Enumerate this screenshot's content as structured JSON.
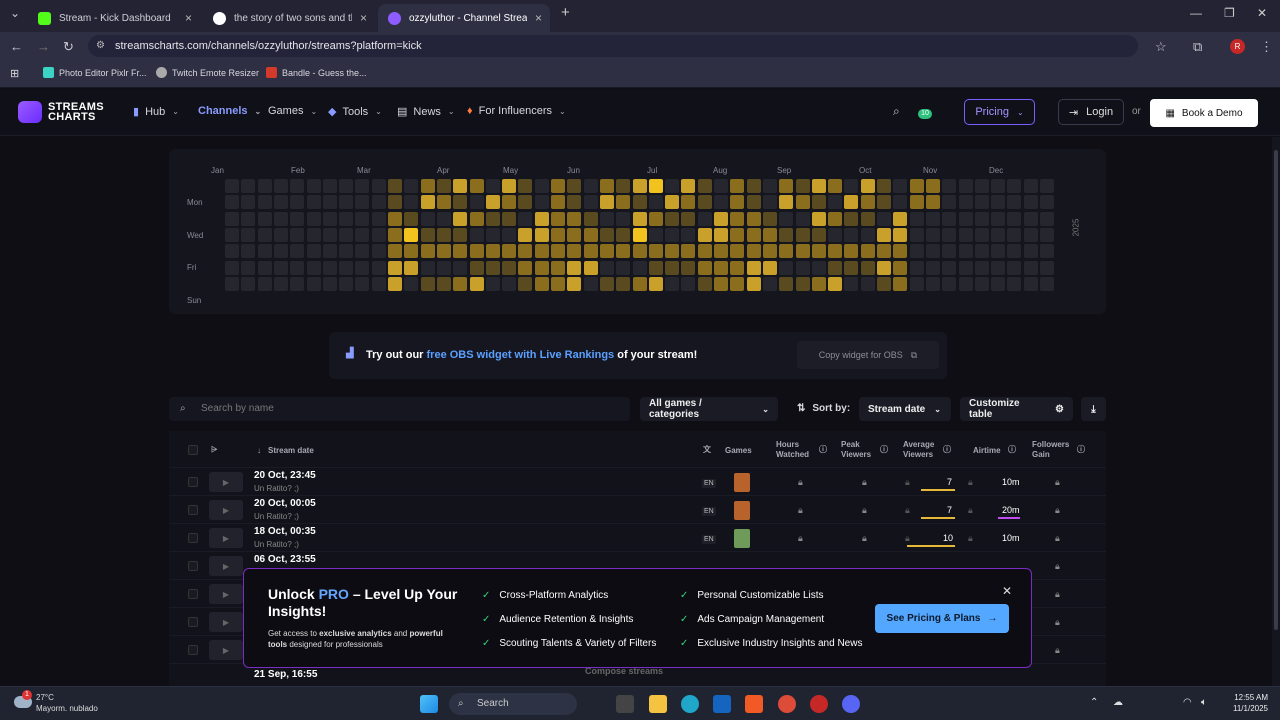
{
  "browser": {
    "tabs": [
      {
        "title": "Stream - Kick Dashboard",
        "icon": "kick-icon",
        "color": "#53fc18"
      },
      {
        "title": "the story of two sons and their",
        "icon": "google-icon",
        "color": "#ffffff"
      },
      {
        "title": "ozzyluthor - Channel Streams o",
        "icon": "streamscharts-icon",
        "color": "#8f5cff"
      }
    ],
    "url": "streamscharts.com/channels/ozzyluthor/streams?platform=kick",
    "bookmarks": [
      {
        "label": "Photo Editor Pixlr Fr...",
        "color": "#3bd4c4"
      },
      {
        "label": "Twitch Emote Resizer",
        "color": "#aaaaaa"
      },
      {
        "label": "Bandle - Guess the...",
        "color": "#d33a2c"
      }
    ],
    "profile": "R"
  },
  "site": {
    "logo": "STREAMS CHARTS",
    "nav": [
      {
        "label": "Hub"
      },
      {
        "label": "Channels"
      },
      {
        "label": "Games"
      },
      {
        "label": "Tools"
      },
      {
        "label": "News"
      },
      {
        "label": "For Influencers"
      }
    ],
    "badge": "10",
    "pricing": "Pricing",
    "login": "Login",
    "or": "or",
    "demo": "Book a Demo"
  },
  "heatmap": {
    "months": [
      "Jan",
      "Feb",
      "Mar",
      "Apr",
      "May",
      "Jun",
      "Jul",
      "Aug",
      "Sep",
      "Oct",
      "Nov",
      "Dec"
    ],
    "days": [
      "Mon",
      "Wed",
      "Fri",
      "Sun"
    ],
    "year": "2025"
  },
  "obs": {
    "prefix": "Try out our",
    "link": "free OBS widget with Live Rankings",
    "suffix": "of your stream!",
    "copy": "Copy widget for OBS"
  },
  "controls": {
    "search_placeholder": "Search by name",
    "games_filter": "All games / categories",
    "sort_by": "Sort by:",
    "sort_value": "Stream date",
    "customize": "Customize table"
  },
  "table": {
    "headers": {
      "stream_date": "Stream date",
      "games": "Games",
      "hours_watched": "Hours Watched",
      "peak_viewers": "Peak Viewers",
      "avg_viewers": "Average Viewers",
      "airtime": "Airtime",
      "followers_gain": "Followers Gain"
    },
    "rows": [
      {
        "date": "20 Oct, 23:45",
        "title": "Un Ratito? ;)",
        "lang": "EN",
        "avg": "7",
        "airtime": "10m"
      },
      {
        "date": "20 Oct, 00:05",
        "title": "Un Ratito? ;)",
        "lang": "EN",
        "avg": "7",
        "airtime": "20m"
      },
      {
        "date": "18 Oct, 00:35",
        "title": "Un Ratito? ;)",
        "lang": "EN",
        "avg": "10",
        "airtime": "10m"
      },
      {
        "date": "06 Oct, 23:55",
        "title": "",
        "lang": "",
        "avg": "",
        "airtime": ""
      }
    ],
    "last_row_date": "21 Sep, 16:55",
    "compose": "Compose streams"
  },
  "promo": {
    "title_a": "Unlock",
    "title_pro": "PRO",
    "title_b": "– Level Up Your Insights!",
    "sub_a": "Get access to",
    "sub_b": "exclusive analytics",
    "sub_c": "and",
    "sub_d": "powerful tools",
    "sub_e": "designed for professionals",
    "features_left": [
      "Cross-Platform Analytics",
      "Audience Retention & Insights",
      "Scouting Talents & Variety of Filters"
    ],
    "features_right": [
      "Personal Customizable Lists",
      "Ads Campaign Management",
      "Exclusive Industry Insights and News"
    ],
    "cta": "See Pricing & Plans"
  },
  "taskbar": {
    "temp": "27°C",
    "weather": "Mayorm. nublado",
    "weather_badge": "1",
    "search": "Search",
    "time": "12:55 AM",
    "date": "11/1/2025"
  }
}
